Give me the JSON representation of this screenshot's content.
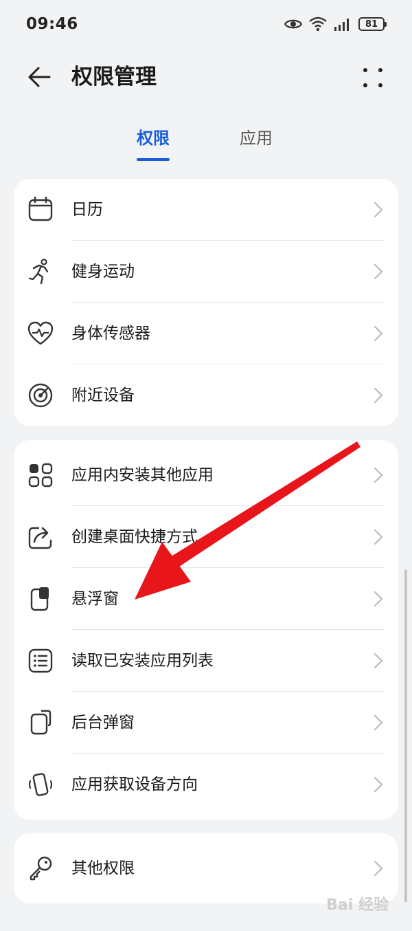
{
  "status_bar": {
    "time": "09:46",
    "battery": "81",
    "icons": [
      "eye-icon",
      "wifi-icon",
      "signal-icon",
      "battery-icon"
    ]
  },
  "header": {
    "title": "权限管理",
    "back_icon": "back-arrow-icon",
    "more_icon": "more-icon"
  },
  "tabs": [
    {
      "label": "权限",
      "active": true
    },
    {
      "label": "应用",
      "active": false
    }
  ],
  "groups": [
    {
      "items": [
        {
          "label": "日历",
          "icon": "calendar-icon"
        },
        {
          "label": "健身运动",
          "icon": "running-icon"
        },
        {
          "label": "身体传感器",
          "icon": "heart-rate-icon"
        },
        {
          "label": "附近设备",
          "icon": "nearby-devices-icon"
        }
      ]
    },
    {
      "items": [
        {
          "label": "应用内安装其他应用",
          "icon": "apps-grid-icon"
        },
        {
          "label": "创建桌面快捷方式",
          "icon": "shortcut-icon"
        },
        {
          "label": "悬浮窗",
          "icon": "floating-window-icon"
        },
        {
          "label": "读取已安装应用列表",
          "icon": "list-icon"
        },
        {
          "label": "后台弹窗",
          "icon": "background-popup-icon"
        },
        {
          "label": "应用获取设备方向",
          "icon": "device-orientation-icon"
        }
      ]
    },
    {
      "items": [
        {
          "label": "其他权限",
          "icon": "key-icon"
        }
      ]
    }
  ],
  "colors": {
    "accent": "#1a5edc",
    "background": "#f1f3f5",
    "annotation": "#e8151b"
  },
  "watermark": "Bai 经验"
}
